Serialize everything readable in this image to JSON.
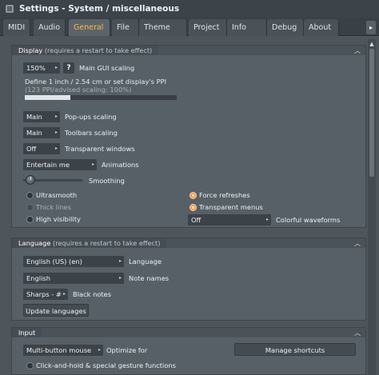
{
  "window": {
    "title": "Settings - System / miscellaneous"
  },
  "tabs": [
    {
      "label": "MIDI"
    },
    {
      "label": "Audio"
    },
    {
      "label": "General"
    },
    {
      "label": "File"
    },
    {
      "label": "Theme"
    },
    {
      "label": "Project"
    },
    {
      "label": "Info"
    },
    {
      "label": "Debug"
    },
    {
      "label": "About"
    }
  ],
  "tab_scroll": "▸",
  "display": {
    "title": "Display",
    "hint": "(requires a restart to take effect)",
    "scaling_value": "150%",
    "help": "?",
    "scaling_label": "Main GUI scaling",
    "ppi_line1": "Define 1 inch / 2.54 cm or set display's PPI",
    "ppi_line2": "(123 PPI/advised scaling: 100%)",
    "ppi_level": 0.3,
    "popups_value": "Main",
    "popups_label": "Pop-ups scaling",
    "toolbars_value": "Main",
    "toolbars_label": "Toolbars scaling",
    "transparent_value": "Off",
    "transparent_label": "Transparent windows",
    "animations_value": "Entertain me",
    "animations_label": "Animations",
    "smoothing_label": "Smoothing",
    "ultrasmooth": "Ultrasmooth",
    "thick_lines": "Thick lines",
    "high_visibility": "High visibility",
    "force_refreshes": "Force refreshes",
    "transparent_menus": "Transparent menus",
    "waveforms_value": "Off",
    "waveforms_label": "Colorful waveforms"
  },
  "language": {
    "title": "Language",
    "hint": "(requires a restart to take effect)",
    "language_value": "English (US) (en)",
    "language_label": "Language",
    "notes_value": "English",
    "notes_label": "Note names",
    "sharps_value": "Sharps - #",
    "sharps_label": "Black notes",
    "update_button": "Update languages"
  },
  "input": {
    "title": "Input",
    "mode_value": "Multi-button mouse",
    "optimize_label": "Optimize for",
    "shortcuts_button": "Manage shortcuts",
    "gesture_label": "Click-and-hold & special gesture functions"
  },
  "colors": {
    "accent": "#ffb648",
    "radio_on": "#ff9a4a",
    "panel": "#576066",
    "background": "#4e565c"
  }
}
